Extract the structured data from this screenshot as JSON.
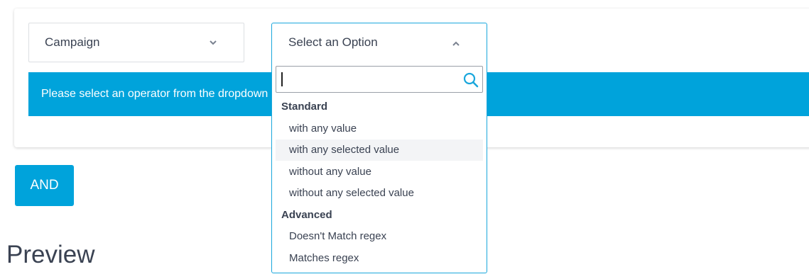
{
  "filter": {
    "field_select": {
      "value": "Campaign",
      "icon": "chevron-down-icon"
    },
    "info_banner": "Please select an operator from the dropdown",
    "operator_select": {
      "placeholder": "Select an Option",
      "icon": "chevron-up-icon",
      "search": {
        "value": "",
        "icon": "search-icon"
      },
      "groups": [
        {
          "label": "Standard",
          "options": [
            "with any value",
            "with any selected value",
            "without any value",
            "without any selected value"
          ]
        },
        {
          "label": "Advanced",
          "options": [
            "Doesn't Match regex",
            "Matches regex"
          ]
        }
      ],
      "highlighted_option": "with any selected value"
    }
  },
  "and_button": "AND",
  "preview_title": "Preview",
  "colors": {
    "accent": "#00a3db",
    "text": "#3a4252",
    "border": "#dcdfe3",
    "hover": "#f3f4f6"
  }
}
